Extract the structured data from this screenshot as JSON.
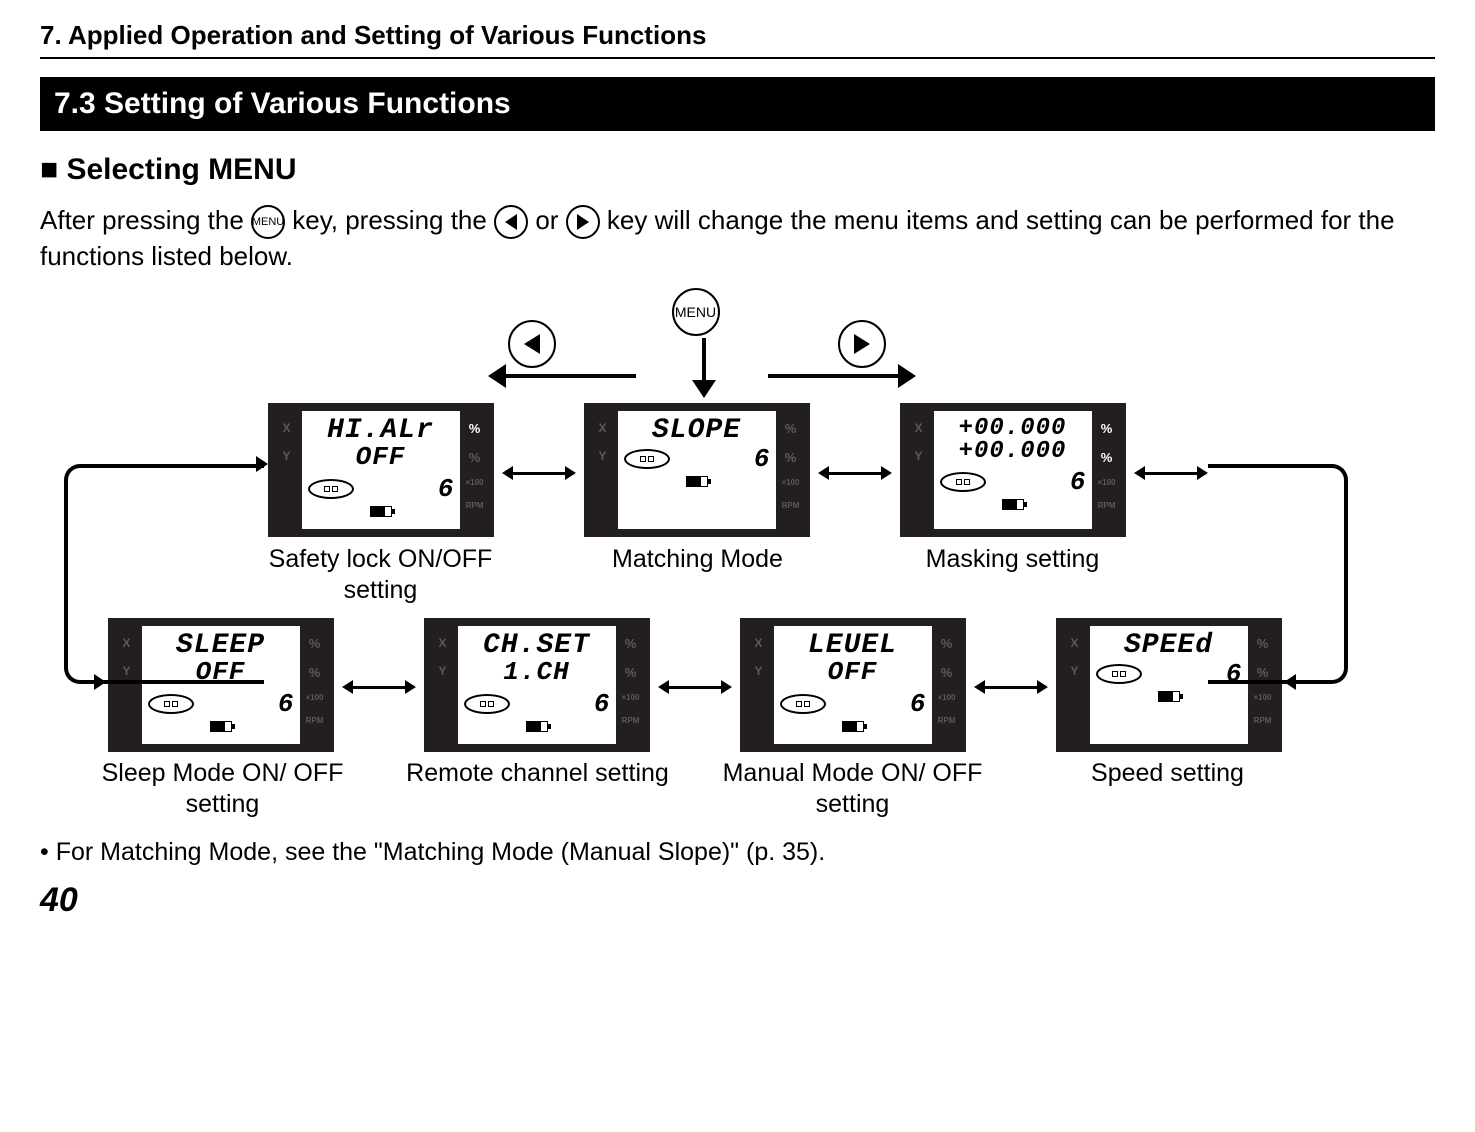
{
  "chapter": {
    "title": "7.  Applied Operation and Setting of Various Functions"
  },
  "section": {
    "title": "7.3  Setting of Various Functions"
  },
  "subhead_marker": "■ ",
  "subhead": "Selecting MENU",
  "intro": {
    "part1": "After pressing the ",
    "key_menu": "MENU",
    "part2": " key, pressing the ",
    "part3": "or",
    "part4": " key will change the menu items and setting can be performed for the functions listed below."
  },
  "keys": {
    "menu": "MENU"
  },
  "tiles": {
    "safety": {
      "line1": "HI.ALr",
      "line2": "OFF",
      "digit": "6",
      "caption": "Safety lock ON/OFF setting"
    },
    "matching": {
      "line1": "SLOPE",
      "line2": "",
      "digit": "6",
      "caption": "Matching Mode"
    },
    "masking": {
      "line1": "+00.000",
      "line2": "+00.000",
      "digit": "6",
      "caption": "Masking setting"
    },
    "sleep": {
      "line1": "SLEEP",
      "line2": "OFF",
      "digit": "6",
      "caption": "Sleep Mode ON/ OFF setting"
    },
    "channel": {
      "line1": "CH.SET",
      "line2": "1.CH",
      "digit": "6",
      "caption": "Remote channel setting"
    },
    "manual": {
      "line1": "LEUEL",
      "line2": "OFF",
      "digit": "6",
      "caption": "Manual Mode ON/ OFF setting"
    },
    "speed": {
      "line1": "SPEEd",
      "line2": "",
      "digit": "6",
      "caption": "Speed setting"
    }
  },
  "side_labels": {
    "x": "X",
    "y": "Y",
    "pct": "%",
    "rpm1": "×100",
    "rpm2": "RPM"
  },
  "note": "•  For Matching Mode, see the \"Matching Mode (Manual Slope)\" (p. 35).",
  "page_number": "40"
}
